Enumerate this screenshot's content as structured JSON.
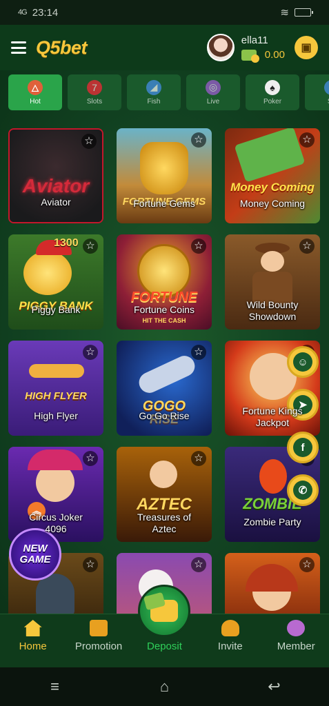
{
  "status_bar": {
    "time": "23:14",
    "signal": "4G"
  },
  "header": {
    "logo": "Q5bet",
    "username": "ella11",
    "balance": "0.00"
  },
  "tabs": [
    {
      "label": "Hot",
      "icon": "flame-icon",
      "active": true
    },
    {
      "label": "Slots",
      "icon": "slot-machine-icon"
    },
    {
      "label": "Fish",
      "icon": "shark-icon"
    },
    {
      "label": "Live",
      "icon": "roulette-icon"
    },
    {
      "label": "Poker",
      "icon": "cards-icon"
    },
    {
      "label": "Sp",
      "icon": "sport-icon"
    }
  ],
  "games": [
    {
      "name": "Aviator"
    },
    {
      "name": "Fortune Gems"
    },
    {
      "name": "Money Coming"
    },
    {
      "name": "Piggy Bank"
    },
    {
      "name": "Fortune Coins"
    },
    {
      "name": "Wild Bounty Showdown"
    },
    {
      "name": "High Flyer"
    },
    {
      "name": "Go Go Rise"
    },
    {
      "name": "Fortune Kings Jackpot"
    },
    {
      "name": "Circus Joker 4096"
    },
    {
      "name": "Treasures of Aztec"
    },
    {
      "name": "Zombie Party"
    },
    {
      "name": ""
    },
    {
      "name": ""
    },
    {
      "name": ""
    }
  ],
  "art_text": {
    "aviator": "Aviator",
    "fortune_gems": "FORTUNE GEMS",
    "money_coming": "Money Coming",
    "piggy_bank": "PIGGY BANK",
    "piggy_badge": "1300",
    "fortune": "FORTUNE",
    "hit_cash": "HIT THE CASH",
    "high_flyer": "HIGH FLYER",
    "gogo": "GOGO",
    "rise": "RISE",
    "aztec": "AZTEC",
    "zombie": "ZOMBIE"
  },
  "new_game_badge": {
    "line1": "NEW",
    "line2": "GAME"
  },
  "bottom_nav": [
    {
      "label": "Home",
      "active": true
    },
    {
      "label": "Promotion"
    },
    {
      "label": "Deposit",
      "active": true
    },
    {
      "label": "Invite"
    },
    {
      "label": "Member"
    }
  ],
  "colors": {
    "accent": "#f6c73c",
    "primary_green": "#2aa44a",
    "bg": "#124322"
  }
}
